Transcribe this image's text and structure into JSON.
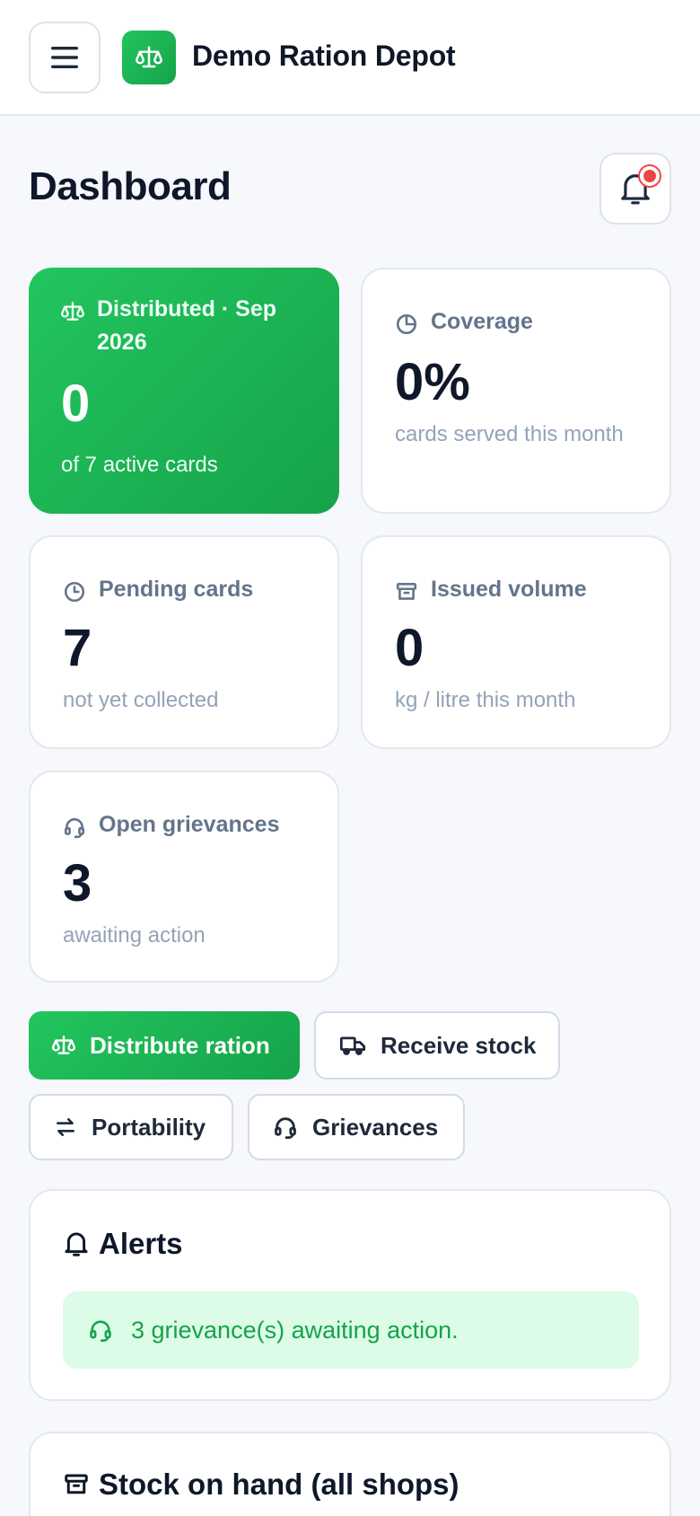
{
  "header": {
    "brand_name": "Demo Ration Depot",
    "menu_icon": "hamburger-icon",
    "brand_icon": "scale-icon"
  },
  "page": {
    "title": "Dashboard",
    "notification_icon": "bell-icon",
    "has_unread": true
  },
  "stats": [
    {
      "label": "Distributed · Sep 2026",
      "value": "0",
      "sub": "of 7 active cards",
      "icon": "scale-icon",
      "highlight": true
    },
    {
      "label": "Coverage",
      "value": "0%",
      "sub": "cards served this month",
      "icon": "pie-chart-icon"
    },
    {
      "label": "Pending cards",
      "value": "7",
      "sub": "not yet collected",
      "icon": "clock-icon"
    },
    {
      "label": "Issued volume",
      "value": "0",
      "sub": "kg / litre this month",
      "icon": "archive-icon"
    },
    {
      "label": "Open grievances",
      "value": "3",
      "sub": "awaiting action",
      "icon": "headset-icon"
    }
  ],
  "actions": [
    {
      "label": "Distribute ration",
      "icon": "scale-icon",
      "primary": true
    },
    {
      "label": "Receive stock",
      "icon": "truck-icon"
    },
    {
      "label": "Portability",
      "icon": "swap-arrows-icon"
    },
    {
      "label": "Grievances",
      "icon": "headset-icon"
    }
  ],
  "alerts": {
    "title": "Alerts",
    "items": [
      {
        "text": "3 grievance(s) awaiting action.",
        "icon": "headset-icon"
      }
    ]
  },
  "stock": {
    "title": "Stock on hand (all shops)",
    "icon": "archive-icon"
  },
  "colors": {
    "accent": "#16a34a",
    "accent_light": "#22c55e",
    "alert_bg": "#dcfce7",
    "badge": "#ef4444"
  }
}
